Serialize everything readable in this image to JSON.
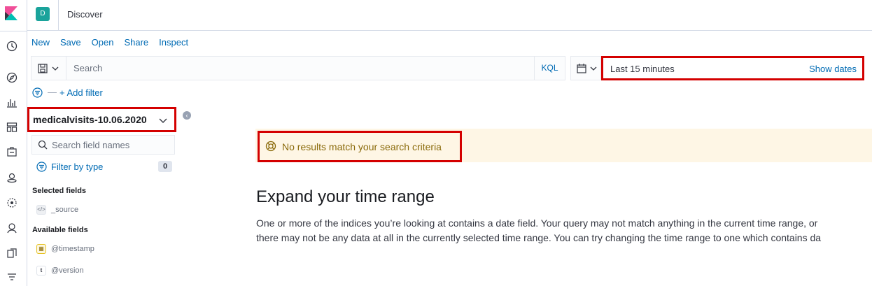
{
  "app": {
    "space_initial": "D",
    "page_title": "Discover"
  },
  "nav": {
    "icons": [
      "recent-icon",
      "discover-icon",
      "visualize-icon",
      "dashboard-icon",
      "canvas-icon",
      "maps-icon",
      "ml-icon",
      "siem-icon",
      "apm-icon",
      "uptime-icon"
    ]
  },
  "topmenu": {
    "new": "New",
    "save": "Save",
    "open": "Open",
    "share": "Share",
    "inspect": "Inspect"
  },
  "query": {
    "placeholder": "Search",
    "language": "KQL"
  },
  "date": {
    "range": "Last 15 minutes",
    "show_dates": "Show dates"
  },
  "filters": {
    "dash": "—",
    "add_filter": "+ Add filter"
  },
  "index_pattern": {
    "name": "medicalvisits-10.06.2020"
  },
  "sidebar": {
    "field_search_placeholder": "Search field names",
    "filter_by_type": "Filter by type",
    "filter_count": "0",
    "selected_fields_title": "Selected fields",
    "selected_fields": [
      {
        "type_icon": "</>",
        "name": "_source"
      }
    ],
    "available_fields_title": "Available fields",
    "available_fields": [
      {
        "type_icon": "▦",
        "name": "@timestamp"
      },
      {
        "type_icon": "t",
        "name": "@version"
      }
    ]
  },
  "main": {
    "callout": "No results match your search criteria",
    "heading": "Expand your time range",
    "paragraph_line1": "One or more of the indices you’re looking at contains a date field. Your query may not match anything in the current time range, or",
    "paragraph_line2": "there may not be any data at all in the currently selected time range. You can try changing the time range to one which contains da"
  },
  "colors": {
    "accent": "#006bb4",
    "highlight_border": "#d40000",
    "callout_bg": "#fef6e5",
    "space_badge": "#1aa39b"
  }
}
